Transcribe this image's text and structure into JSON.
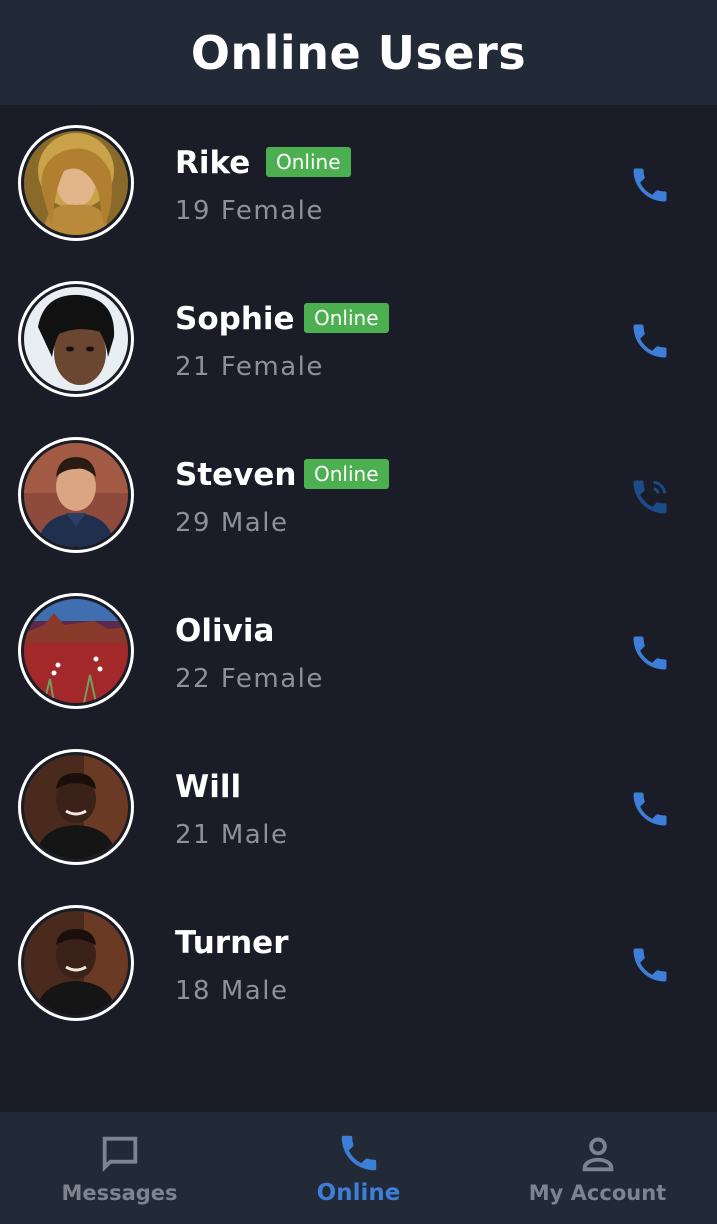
{
  "header": {
    "title": "Online Users"
  },
  "users": [
    {
      "name": "Rike",
      "status": "Online",
      "meta": "19 Female",
      "avatar": "woman-blonde",
      "call_icon": "phone-icon"
    },
    {
      "name": "Sophie",
      "status": "Online",
      "meta": "21 Female",
      "avatar": "woman-short-hair",
      "call_icon": "phone-icon"
    },
    {
      "name": "Steven",
      "status": "Online",
      "meta": "29 Male",
      "avatar": "man-smiling",
      "call_icon": "phone-in-talk-icon"
    },
    {
      "name": "Olivia",
      "status": "",
      "meta": "22 Female",
      "avatar": "desert-landscape",
      "call_icon": "phone-icon"
    },
    {
      "name": "Will",
      "status": "",
      "meta": "21 Male",
      "avatar": "man-portrait",
      "call_icon": "phone-icon"
    },
    {
      "name": "Turner",
      "status": "",
      "meta": "18 Male",
      "avatar": "man-portrait",
      "call_icon": "phone-icon"
    }
  ],
  "nav": {
    "items": [
      {
        "label": "Messages",
        "icon": "chat-icon",
        "active": false
      },
      {
        "label": "Online",
        "icon": "phone-icon",
        "active": true
      },
      {
        "label": "My Account",
        "icon": "account-icon",
        "active": false
      }
    ]
  },
  "colors": {
    "background": "#1a1d27",
    "header": "#222a38",
    "accent": "#3d7ed8",
    "online_badge": "#4caf50",
    "muted_text": "#8c919c"
  }
}
